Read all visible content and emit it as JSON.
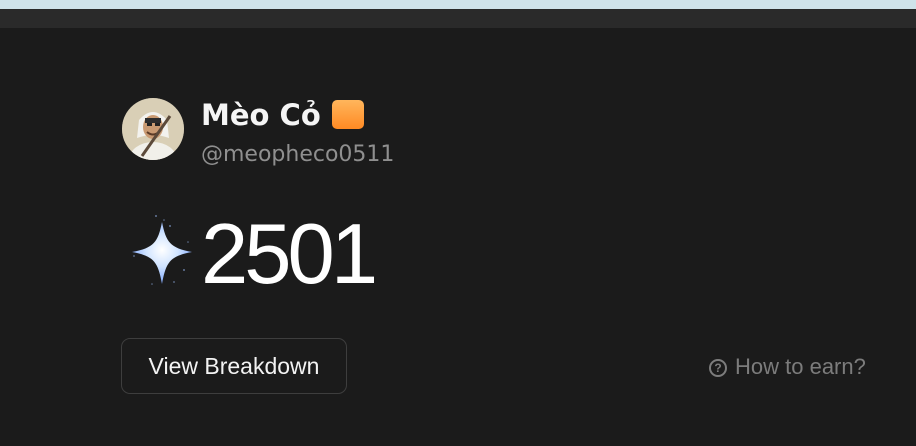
{
  "profile": {
    "display_name": "Mèo Cỏ",
    "handle": "@meopheco0511"
  },
  "points": {
    "value": "2501"
  },
  "actions": {
    "view_breakdown_label": "View Breakdown",
    "how_to_earn_label": "How to earn?"
  },
  "icons": {
    "question": "?"
  },
  "colors": {
    "background": "#1b1b1b",
    "top_accent": "#cfe3ea",
    "badge_orange": "#ff9a35",
    "muted_text": "#8f8f8f"
  }
}
